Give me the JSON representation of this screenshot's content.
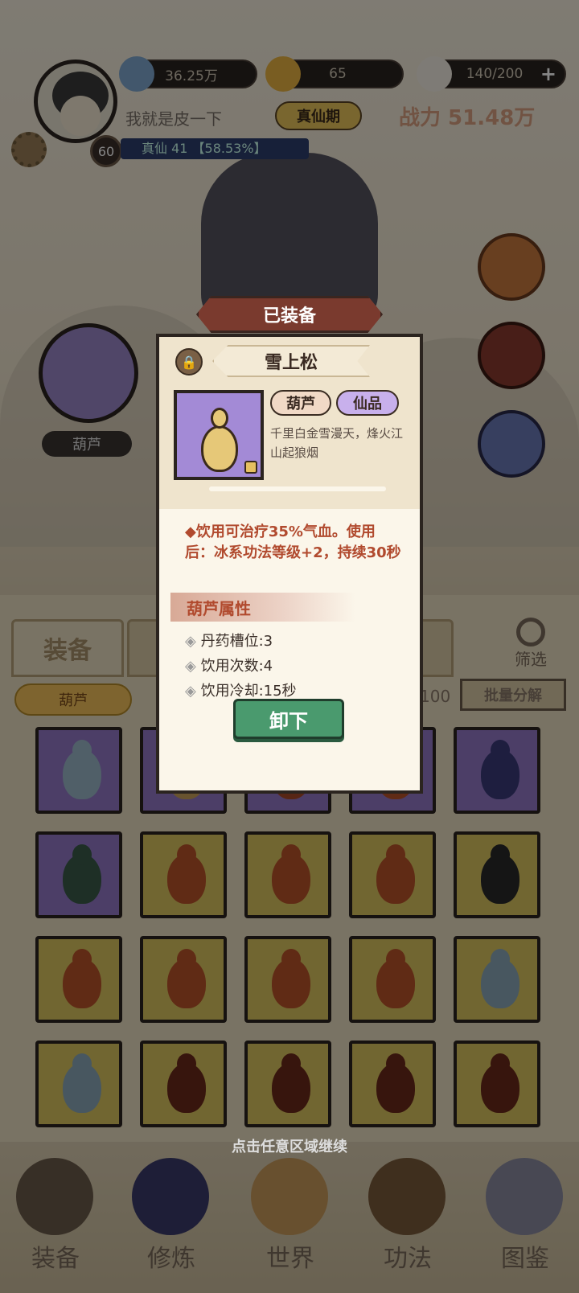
{
  "header": {
    "spirit_stones": "36.25万",
    "gold": "65",
    "stamina": "140/200",
    "player_name": "我就是皮一下",
    "realm_badge": "真仙期",
    "combat_power": "战力 51.48万",
    "level": "60",
    "exp_text": "真仙 41  【58.53%】"
  },
  "left_slot_label": "葫芦",
  "tabs": {
    "equipment": "装备",
    "filter": "筛选"
  },
  "filter_bar": {
    "category": "葫芦",
    "count": "100",
    "batch_btn": "批量分解"
  },
  "modal": {
    "banner": "已装备",
    "title": "雪上松",
    "tag_type": "葫芦",
    "tag_rarity": "仙品",
    "description": "千里白金雪漫天，烽火江山起狼烟",
    "effect": "◆饮用可治疗35%气血。使用后：冰系功法等级+2，持续30秒",
    "section_title": "葫芦属性",
    "attrs": {
      "a1": "丹药槽位:3",
      "a2": "饮用次数:4",
      "a3": "饮用冷却:15秒"
    },
    "unequip": "卸下"
  },
  "hint": "点击任意区域继续",
  "nav": {
    "n1": "装备",
    "n2": "修炼",
    "n3": "世界",
    "n4": "功法",
    "n5": "图鉴"
  },
  "colors": {
    "rarity_purple": "#9278c6",
    "rarity_gold": "#d8c35e",
    "accent_red": "#b14a2e",
    "button_green": "#4a9a6e"
  }
}
